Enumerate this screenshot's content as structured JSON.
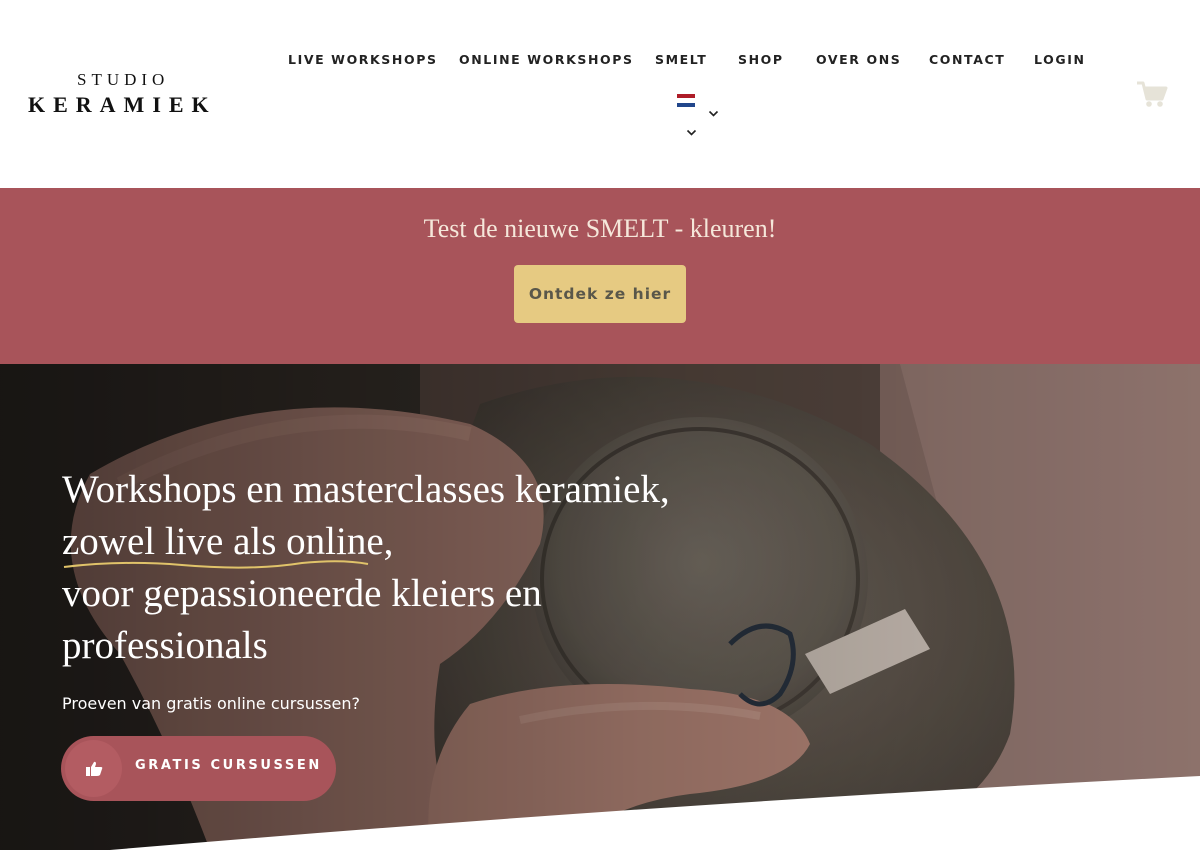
{
  "header": {
    "logo": {
      "line1": "STUDIO",
      "line2": "KERAMIEK"
    },
    "nav": [
      {
        "label": "LIVE WORKSHOPS"
      },
      {
        "label": "ONLINE WORKSHOPS"
      },
      {
        "label": "SMELT"
      },
      {
        "label": "SHOP"
      },
      {
        "label": "OVER ONS"
      },
      {
        "label": "CONTACT"
      },
      {
        "label": "LOGIN"
      }
    ],
    "language": {
      "icon": "netherlands-flag-icon"
    },
    "cart": {
      "icon": "shopping-cart-icon"
    }
  },
  "promo": {
    "title": "Test de nieuwe SMELT - kleuren!",
    "button": "Ontdek ze hier"
  },
  "hero": {
    "heading_lines": [
      "Workshops en masterclasses keramiek,",
      "zowel live als online,",
      "voor gepassioneerde kleiers en",
      "professionals"
    ],
    "subtitle": "Proeven van gratis online cursussen?",
    "cta": {
      "label": "GRATIS CURSUSSEN",
      "icon": "thumbs-up-pointing-hand-icon"
    }
  },
  "colors": {
    "brand_rose": "#a8545a",
    "button_gold": "#e6ca82",
    "promo_text": "#f5e7da",
    "underline_gold": "#e0c36a",
    "cart_icon": "#e6e3d8"
  }
}
